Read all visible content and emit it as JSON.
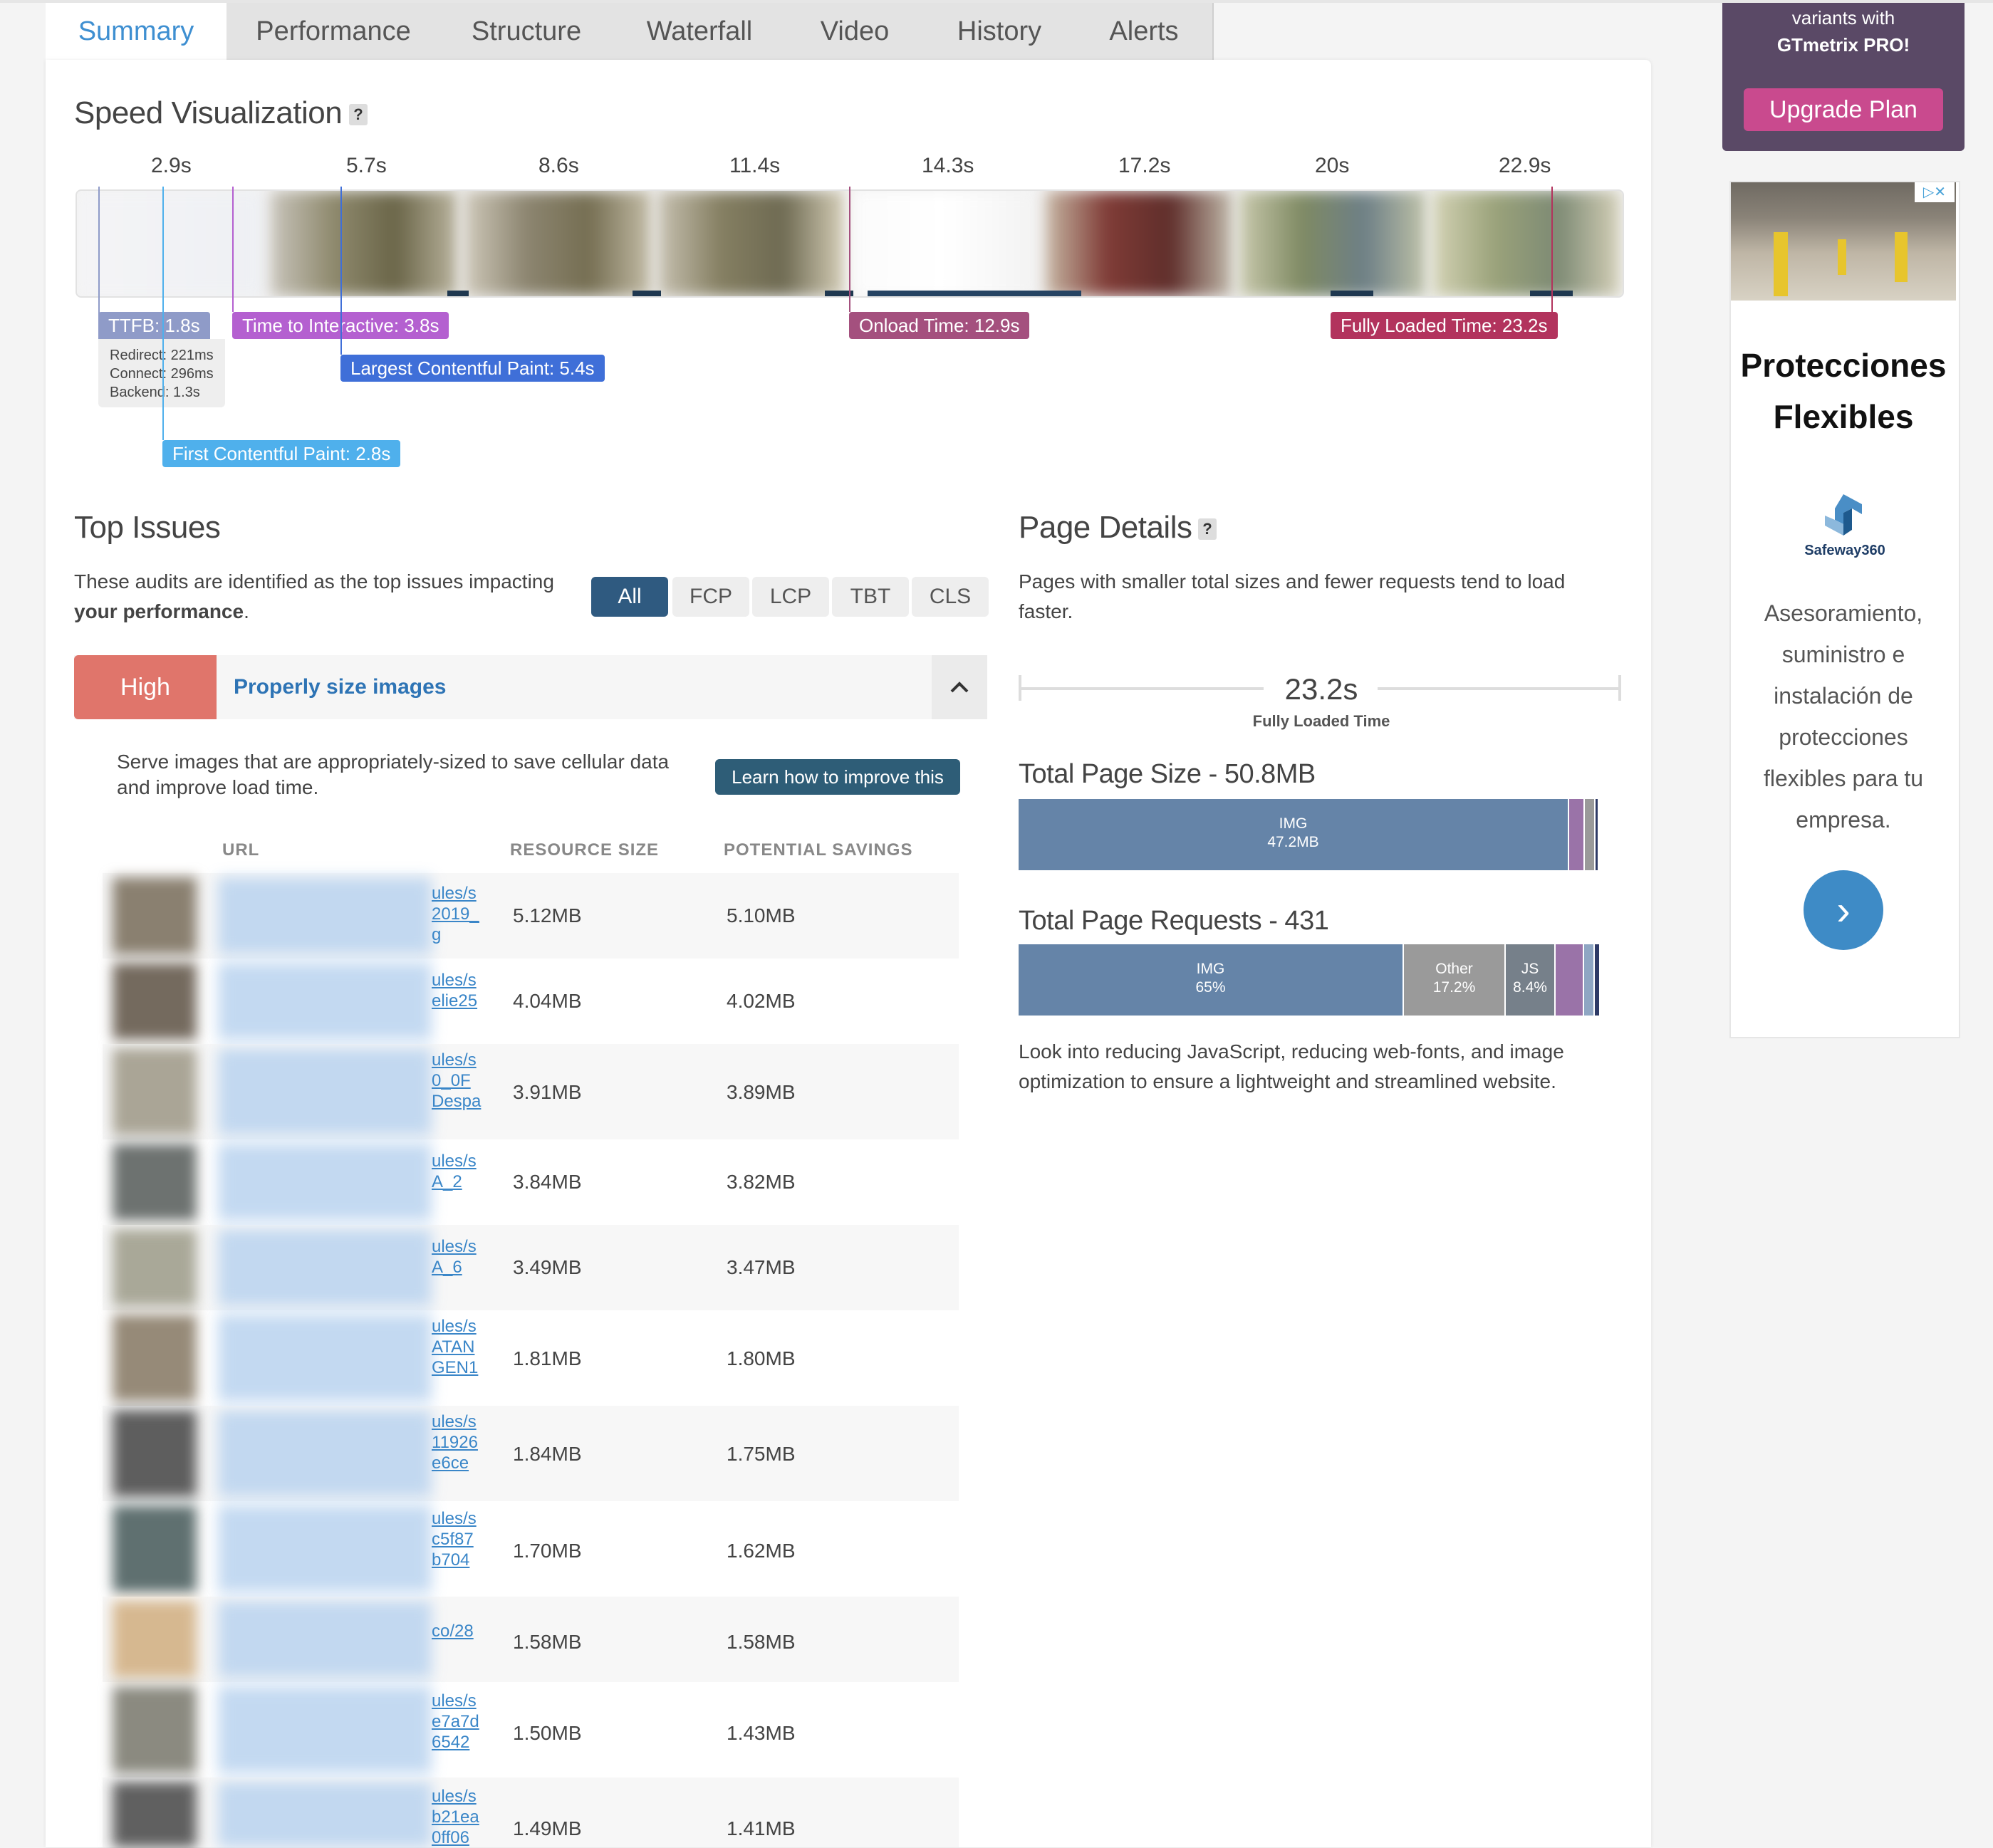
{
  "tabs": [
    "Summary",
    "Performance",
    "Structure",
    "Waterfall",
    "Video",
    "History",
    "Alerts"
  ],
  "speed": {
    "title": "Speed Visualization",
    "help": "?",
    "ticks": [
      "2.9s",
      "5.7s",
      "8.6s",
      "11.4s",
      "14.3s",
      "17.2s",
      "20s",
      "22.9s"
    ],
    "markers": {
      "ttfb": "TTFB: 1.8s",
      "redirect": "Redirect: 221ms",
      "connect": "Connect: 296ms",
      "backend": "Backend: 1.3s",
      "tti": "Time to Interactive: 3.8s",
      "lcp": "Largest Contentful Paint: 5.4s",
      "fcp": "First Contentful Paint: 2.8s",
      "onload": "Onload Time: 12.9s",
      "fully": "Fully Loaded Time: 23.2s"
    }
  },
  "top_issues": {
    "title": "Top Issues",
    "desc_line1": "These audits are identified as the top issues impacting",
    "desc_bold": "your performance",
    "desc_end": ".",
    "filters": [
      "All",
      "FCP",
      "LCP",
      "TBT",
      "CLS"
    ],
    "issue": {
      "severity": "High",
      "title": "Properly size images",
      "collapse_icon": "^",
      "desc": "Serve images that are appropriately-sized to save cellular data and improve load time.",
      "learn": "Learn how to improve this"
    },
    "columns": [
      "URL",
      "RESOURCE SIZE",
      "POTENTIAL SAVINGS"
    ],
    "rows": [
      {
        "url": "ules/s\n2019_\ng",
        "size": "5.12MB",
        "savings": "5.10MB"
      },
      {
        "url": "ules/s\nelie25",
        "size": "4.04MB",
        "savings": "4.02MB"
      },
      {
        "url": "ules/s\n0_0F\nDespa",
        "size": "3.91MB",
        "savings": "3.89MB"
      },
      {
        "url": "ules/s\nA_2",
        "size": "3.84MB",
        "savings": "3.82MB"
      },
      {
        "url": "ules/s\nA_6",
        "size": "3.49MB",
        "savings": "3.47MB"
      },
      {
        "url": "ules/s\nATAN\nGEN1",
        "size": "1.81MB",
        "savings": "1.80MB"
      },
      {
        "url": "ules/s\n11926\ne6ce",
        "size": "1.84MB",
        "savings": "1.75MB"
      },
      {
        "url": "ules/s\nc5f87\nb704",
        "size": "1.70MB",
        "savings": "1.62MB"
      },
      {
        "url": "co/28",
        "size": "1.58MB",
        "savings": "1.58MB"
      },
      {
        "url": "ules/s\ne7a7d\n6542",
        "size": "1.50MB",
        "savings": "1.43MB"
      },
      {
        "url": "ules/s\nb21ea\n0ff06",
        "size": "1.49MB",
        "savings": "1.41MB"
      }
    ]
  },
  "page_details": {
    "title": "Page Details",
    "help": "?",
    "desc": "Pages with smaller total sizes and fewer requests tend to load faster.",
    "fully_loaded_value": "23.2s",
    "fully_loaded_label": "Fully Loaded Time",
    "size_title": "Total Page Size - 50.8MB",
    "size_segments": [
      {
        "label": "IMG",
        "value": "47.2MB",
        "fraction": 0.929,
        "color": "#6584a8"
      },
      {
        "label": "",
        "value": "",
        "fraction": 0.026,
        "color": "#9a73a8"
      },
      {
        "label": "",
        "value": "",
        "fraction": 0.018,
        "color": "#9a9a9a"
      },
      {
        "label": "",
        "value": "",
        "fraction": 0.006,
        "color": "#2e3a66"
      }
    ],
    "requests_title": "Total Page Requests - 431",
    "request_segments": [
      {
        "label": "IMG",
        "value": "65%",
        "fraction": 0.65,
        "color": "#6584a8"
      },
      {
        "label": "Other",
        "value": "17.2%",
        "fraction": 0.172,
        "color": "#9a9a9a"
      },
      {
        "label": "JS",
        "value": "8.4%",
        "fraction": 0.084,
        "color": "#76808a"
      },
      {
        "label": "",
        "value": "",
        "fraction": 0.048,
        "color": "#9a73a8"
      },
      {
        "label": "",
        "value": "",
        "fraction": 0.018,
        "color": "#8fa6c3"
      },
      {
        "label": "",
        "value": "",
        "fraction": 0.01,
        "color": "#2e3a66"
      }
    ],
    "note": "Look into reducing JavaScript, reducing web-fonts, and image optimization to ensure a lightweight and streamlined website."
  },
  "sidebar": {
    "promo_line1": "variants with",
    "promo_line2": "GTmetrix PRO!",
    "upgrade": "Upgrade Plan",
    "ad_close": "▷✕",
    "ad_title_1": "Protecciones",
    "ad_title_2": "Flexibles",
    "ad_brand": "Safeway360",
    "ad_body": "Asesoramiento, suministro e instalación de protecciones flexibles para tu empresa.",
    "ad_arrow": "›"
  },
  "colors": {
    "accent": "#3e8fd1",
    "high": "#e0756b",
    "ttfb": "#8f9bc8",
    "tti": "#b460d0",
    "lcp": "#3f6fd8",
    "fcp": "#4fb0ec",
    "onload": "#a4507e",
    "fully": "#b2335d",
    "promo": "#5a4966",
    "upgrade": "#c94a8e"
  }
}
